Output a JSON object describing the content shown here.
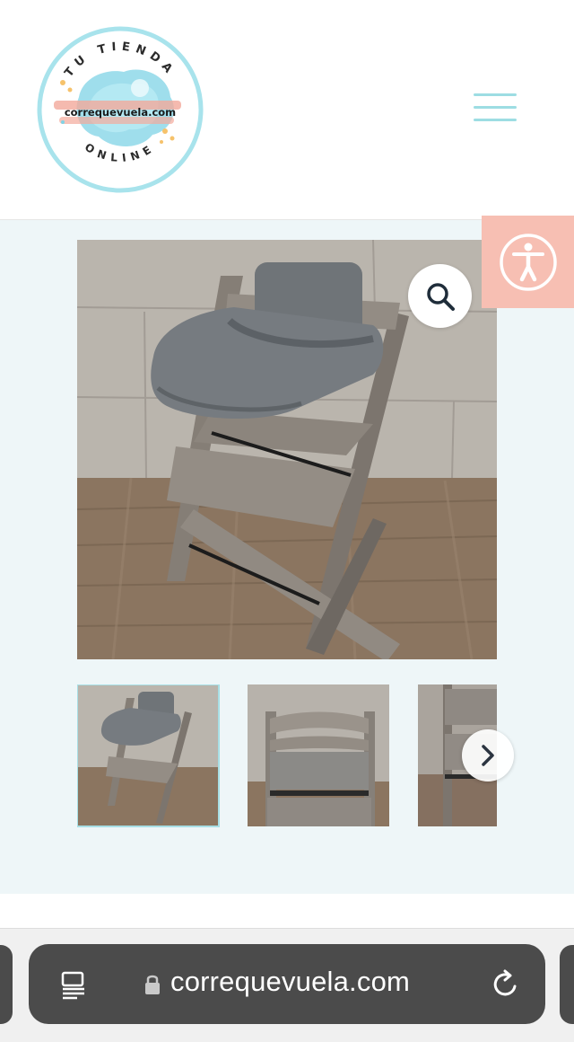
{
  "logo": {
    "top_text": "TU TIENDA",
    "brand": "correquevuela.com",
    "bottom_text": "ONLINE",
    "colors": {
      "ring": "#a8e3ec",
      "splash": "#7fd3e6",
      "stripe": "#f3a99b",
      "dots": "#f6c26b"
    }
  },
  "header": {
    "menu_icon": "hamburger-icon"
  },
  "accessibility": {
    "icon": "accessibility-icon",
    "color": "#f7bfb3"
  },
  "gallery": {
    "main_image": "grey wooden high chair with tray and baby backrest",
    "zoom_icon": "magnifier-icon",
    "thumbnails": [
      {
        "alt": "high chair with tray",
        "active": true
      },
      {
        "alt": "high chair backrest view",
        "active": false
      },
      {
        "alt": "high chair side view",
        "active": false
      }
    ],
    "next_icon": "chevron-right-icon"
  },
  "browser": {
    "url": "correquevuela.com",
    "icons": [
      "reader-icon",
      "lock-icon",
      "reload-icon"
    ]
  }
}
